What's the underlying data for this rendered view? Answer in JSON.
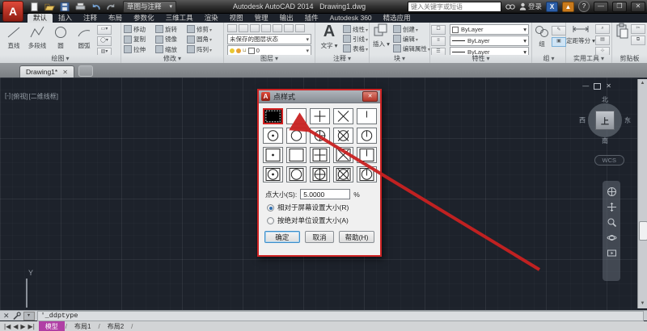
{
  "title_bar": {
    "app_title": "Autodesk AutoCAD 2014",
    "doc_title": "Drawing1.dwg",
    "workspace": "草图与注释",
    "search_placeholder": "键入关键字或短语",
    "sign_in_label": "登录",
    "qat_icons": [
      "new-file-icon",
      "open-folder-icon",
      "save-icon",
      "plot-icon",
      "undo-icon",
      "redo-icon"
    ],
    "window_buttons": [
      "minimize",
      "maximize",
      "close"
    ]
  },
  "ribbon": {
    "tabs": [
      {
        "label": "默认",
        "active": true
      },
      {
        "label": "插入"
      },
      {
        "label": "注释"
      },
      {
        "label": "布局"
      },
      {
        "label": "参数化"
      },
      {
        "label": "三维工具"
      },
      {
        "label": "渲染"
      },
      {
        "label": "视图"
      },
      {
        "label": "管理"
      },
      {
        "label": "输出"
      },
      {
        "label": "插件"
      },
      {
        "label": "Autodesk 360"
      },
      {
        "label": "精选应用"
      }
    ],
    "draw_panel": {
      "label": "绘图",
      "items": [
        "直线",
        "多段线",
        "圆",
        "圆弧"
      ]
    },
    "modify_panel": {
      "label": "修改",
      "items": [
        "移动",
        "旋转",
        "修剪",
        "复制",
        "镜像",
        "圆角",
        "拉伸",
        "缩放",
        "阵列"
      ]
    },
    "layers_panel": {
      "label": "图层",
      "state_dropdown": "未保存的图层状态",
      "current_layer": "0"
    },
    "annotation_panel": {
      "label": "注释",
      "big_button": "文字",
      "items": [
        "线性",
        "引线",
        "表格"
      ]
    },
    "block_panel": {
      "label": "块",
      "big_button": "插入",
      "items": [
        "创建",
        "编辑",
        "编辑属性"
      ]
    },
    "properties_panel": {
      "label": "特性",
      "rows": [
        "ByLayer",
        "ByLayer",
        "ByLayer"
      ]
    },
    "group_panel": {
      "label": "组",
      "big_button": "组"
    },
    "utilities_panel": {
      "label": "实用工具",
      "big_button": "定距等分"
    },
    "clipboard_panel": {
      "label": "剪贴板"
    }
  },
  "file_tabs": {
    "active_tab": "Drawing1*"
  },
  "canvas": {
    "viewport_controls": [
      "[-]",
      "[俯视]",
      "[二维线框]"
    ],
    "viewcube": {
      "north": "北",
      "south": "南",
      "west": "西",
      "east": "东",
      "top": "上",
      "wcs": "WCS"
    },
    "nav_tools": [
      "steering-wheel-icon",
      "pan-icon",
      "zoom-icon",
      "orbit-icon",
      "show-motion-icon"
    ],
    "ucs_axis_label": "Y"
  },
  "dialog": {
    "title": "点样式",
    "point_styles": [
      {
        "id": "dot",
        "parts": [
          "dot"
        ],
        "selected": true
      },
      {
        "id": "blank",
        "parts": []
      },
      {
        "id": "plus",
        "parts": [
          "plus"
        ]
      },
      {
        "id": "cross",
        "parts": [
          "cross"
        ]
      },
      {
        "id": "tick",
        "parts": [
          "tick"
        ]
      },
      {
        "id": "circle-dot",
        "parts": [
          "circle",
          "dot"
        ]
      },
      {
        "id": "circle",
        "parts": [
          "circle"
        ]
      },
      {
        "id": "circle-plus",
        "parts": [
          "circle",
          "plus"
        ]
      },
      {
        "id": "circle-cross",
        "parts": [
          "circle",
          "cross"
        ]
      },
      {
        "id": "circle-tick",
        "parts": [
          "circle",
          "tick"
        ]
      },
      {
        "id": "square-dot",
        "parts": [
          "square",
          "dot"
        ]
      },
      {
        "id": "square",
        "parts": [
          "square"
        ]
      },
      {
        "id": "square-plus",
        "parts": [
          "square",
          "plus"
        ]
      },
      {
        "id": "square-cross",
        "parts": [
          "square",
          "cross"
        ]
      },
      {
        "id": "square-tick",
        "parts": [
          "square",
          "tick"
        ]
      },
      {
        "id": "square-circle-dot",
        "parts": [
          "square",
          "circle",
          "dot"
        ]
      },
      {
        "id": "square-circle",
        "parts": [
          "square",
          "circle"
        ]
      },
      {
        "id": "square-circle-plus",
        "parts": [
          "square",
          "circle",
          "plus"
        ]
      },
      {
        "id": "square-circle-cross",
        "parts": [
          "square",
          "circle",
          "cross"
        ]
      },
      {
        "id": "square-circle-tick",
        "parts": [
          "square",
          "circle",
          "tick"
        ]
      }
    ],
    "point_size_label": "点大小(S):",
    "point_size_value": "5.0000",
    "unit_suffix": "%",
    "radio_relative": "相对于屏幕设置大小(R)",
    "radio_absolute": "按绝对单位设置大小(A)",
    "radio_selected": "relative",
    "ok_label": "确定",
    "cancel_label": "取消",
    "help_label": "帮助(H)"
  },
  "command_bar": {
    "command_text": "'_ddptype"
  },
  "status_bar": {
    "nav_icons": [
      "|◀",
      "◀",
      "▶",
      "▶|"
    ],
    "tabs": [
      {
        "label": "模型",
        "active": true
      },
      {
        "label": "布局1"
      },
      {
        "label": "布局2"
      }
    ]
  },
  "colors": {
    "annotation_red": "#cf2424",
    "model_tab_magenta": "#b03fa5",
    "canvas_background": "#1d222b",
    "focus_blue": "#3d8ec9"
  }
}
